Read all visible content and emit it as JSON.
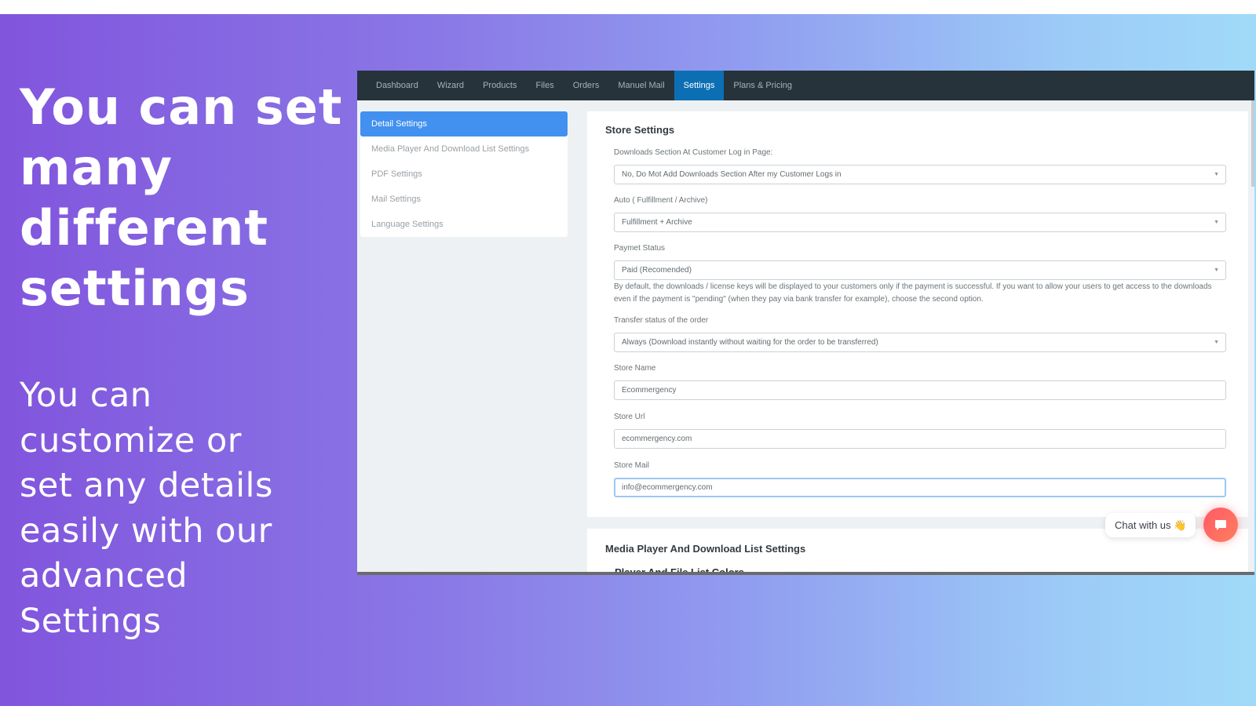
{
  "hero": {
    "title_lines": [
      "You can set",
      "many",
      "different",
      "settings"
    ],
    "subtitle_lines": [
      "You can",
      "customize or",
      "set any details",
      "easily with our",
      "advanced",
      "Settings"
    ]
  },
  "navbar": {
    "items": [
      {
        "label": "Dashboard",
        "active": false
      },
      {
        "label": "Wizard",
        "active": false
      },
      {
        "label": "Products",
        "active": false
      },
      {
        "label": "Files",
        "active": false
      },
      {
        "label": "Orders",
        "active": false
      },
      {
        "label": "Manuel Mail",
        "active": false
      },
      {
        "label": "Settings",
        "active": true
      },
      {
        "label": "Plans & Pricing",
        "active": false
      }
    ]
  },
  "sidebar": {
    "items": [
      {
        "label": "Detail Settings",
        "active": true
      },
      {
        "label": "Media Player And Download List Settings",
        "active": false
      },
      {
        "label": "PDF Settings",
        "active": false
      },
      {
        "label": "Mail Settings",
        "active": false
      },
      {
        "label": "Language Settings",
        "active": false
      }
    ]
  },
  "store_settings": {
    "title": "Store Settings",
    "downloads_section": {
      "label": "Downloads Section At Customer Log in Page:",
      "value": "No, Do Mot Add Downloads Section After my Customer Logs in"
    },
    "auto_fulfillment": {
      "label": "Auto ( Fulfillment / Archive)",
      "value": "Fulfillment + Archive"
    },
    "payment_status": {
      "label": "Paymet Status",
      "value": "Paid (Recomended)",
      "help": "By default, the downloads / license keys will be displayed to your customers only if the payment is successful. If you want to allow your users to get access to the downloads even if the payment is \"pending\" (when they pay via bank transfer for example), choose the second option."
    },
    "transfer_status": {
      "label": "Transfer status of the order",
      "value": "Always (Download instantly without waiting for the order to be transferred)"
    },
    "store_name": {
      "label": "Store Name",
      "value": "Ecommergency"
    },
    "store_url": {
      "label": "Store Url",
      "value": "ecommergency.com"
    },
    "store_mail": {
      "label": "Store Mail",
      "value": "info@ecommergency.com"
    }
  },
  "media_settings": {
    "title": "Media Player And Download List Settings",
    "subtitle": "Player And File List Colors"
  },
  "chat": {
    "label": "Chat with us",
    "emoji": "👋",
    "accent": "#ff5a66"
  },
  "icons": {
    "caret": "▼"
  }
}
